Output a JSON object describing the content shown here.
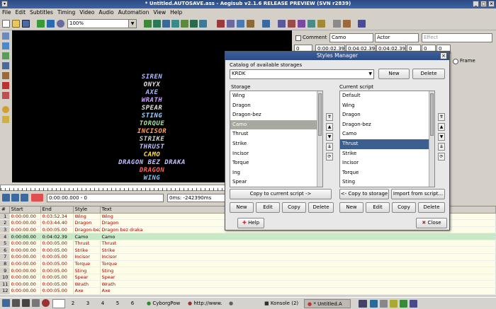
{
  "window": {
    "title": "* Untitled.AUTOSAVE.ass - Aegisub v2.1.6 RELEASE PREVIEW (SVN r2839)"
  },
  "menu": [
    "File",
    "Edit",
    "Subtitles",
    "Timing",
    "Video",
    "Audio",
    "Automation",
    "View",
    "Help"
  ],
  "toolbar": {
    "zoom": "100%"
  },
  "video": {
    "lines": [
      {
        "text": "SIREN",
        "color": "#b0b8ff"
      },
      {
        "text": "ONYX",
        "color": "#e0e0e0"
      },
      {
        "text": "AXE",
        "color": "#9fb6ff"
      },
      {
        "text": "WRATH",
        "color": "#c8a0ff"
      },
      {
        "text": "SPEAR",
        "color": "#e0e0e0"
      },
      {
        "text": "STING",
        "color": "#a0d0ff"
      },
      {
        "text": "TORQUE",
        "color": "#a0e0a0"
      },
      {
        "text": "INCISOR",
        "color": "#ffa060"
      },
      {
        "text": "STRIKE",
        "color": "#d0d0d0"
      },
      {
        "text": "THRUST",
        "color": "#c0c0ff"
      },
      {
        "text": "CAMO",
        "color": "#ffe040"
      },
      {
        "text": "DRAGON BEZ DRAKA",
        "color": "#c0c0ff"
      },
      {
        "text": "DRAGON",
        "color": "#ff6060"
      },
      {
        "text": "WING",
        "color": "#80c0ff"
      }
    ]
  },
  "playback": {
    "time": "0:00:00.000 - 0",
    "offset": "0ms: -242390ms"
  },
  "edit": {
    "comment_label": "Comment",
    "style": "Camo",
    "actor": "Actor",
    "effect_placeholder": "Effect",
    "layer": "0",
    "start": "0:00:02.39",
    "end": "0:04:02.39",
    "duration": "0:04:02.39",
    "m1": "0",
    "m2": "0",
    "m3": "0",
    "frame_label": "Frame"
  },
  "grid": {
    "headers": [
      "#",
      "Start",
      "End",
      "Style",
      "Text"
    ],
    "rows": [
      [
        "1",
        "0:00:00.00",
        "0:03:52.34",
        "Wing",
        "Wing"
      ],
      [
        "2",
        "0:00:00.00",
        "0:03:44.40",
        "Dragon",
        "Dragon"
      ],
      [
        "3",
        "0:00:00.00",
        "0:00:05.00",
        "Dragon-bez",
        "Dragon bez draka"
      ],
      [
        "4",
        "0:00:00.00",
        "0:04:02.39",
        "Camo",
        "Camo"
      ],
      [
        "5",
        "0:00:00.00",
        "0:00:05.00",
        "Thrust",
        "Thrust"
      ],
      [
        "6",
        "0:00:00.00",
        "0:00:05.00",
        "Strike",
        "Strike"
      ],
      [
        "7",
        "0:00:00.00",
        "0:00:05.00",
        "Incisor",
        "Incisor"
      ],
      [
        "8",
        "0:00:00.00",
        "0:00:05.00",
        "Torque",
        "Torque"
      ],
      [
        "9",
        "0:00:00.00",
        "0:00:05.00",
        "Sting",
        "Sting"
      ],
      [
        "10",
        "0:00:00.00",
        "0:00:05.00",
        "Spear",
        "Spear"
      ],
      [
        "11",
        "0:00:00.00",
        "0:00:05.00",
        "Wrath",
        "Wrath"
      ],
      [
        "12",
        "0:00:00.00",
        "0:00:05.00",
        "Axe",
        "Axe"
      ]
    ],
    "selected_row": 3
  },
  "dialog": {
    "title": "Styles Manager",
    "catalog_label": "Catalog of available storages",
    "catalog_value": "KRDK",
    "new_label": "New",
    "delete_label": "Delete",
    "storage_label": "Storage",
    "storage_items": [
      "Wing",
      "Dragon",
      "Dragon-bez",
      "Camo",
      "Thrust",
      "Strike",
      "Incisor",
      "Torque",
      "Ing",
      "Spear"
    ],
    "storage_selected": 3,
    "current_label": "Current script",
    "current_items": [
      "Default",
      "Wing",
      "Dragon",
      "Dragon-bez",
      "Camo",
      "Thrust",
      "Strike",
      "Incisor",
      "Torque",
      "Sting"
    ],
    "current_selected": 5,
    "copy_to_current": "Copy to current script ->",
    "copy_to_storage": "<- Copy to storage",
    "import_from": "Import from script...",
    "btn_new": "New",
    "btn_edit": "Edit",
    "btn_copy": "Copy",
    "btn_delete": "Delete",
    "help": "Help",
    "close": "Close"
  },
  "taskbar": {
    "workspaces": [
      "2",
      "3",
      "4",
      "5",
      "6"
    ],
    "tasks": [
      "CyborgPow",
      "http://www.",
      "",
      "Konsole (2)",
      "* Untitled.A"
    ]
  }
}
